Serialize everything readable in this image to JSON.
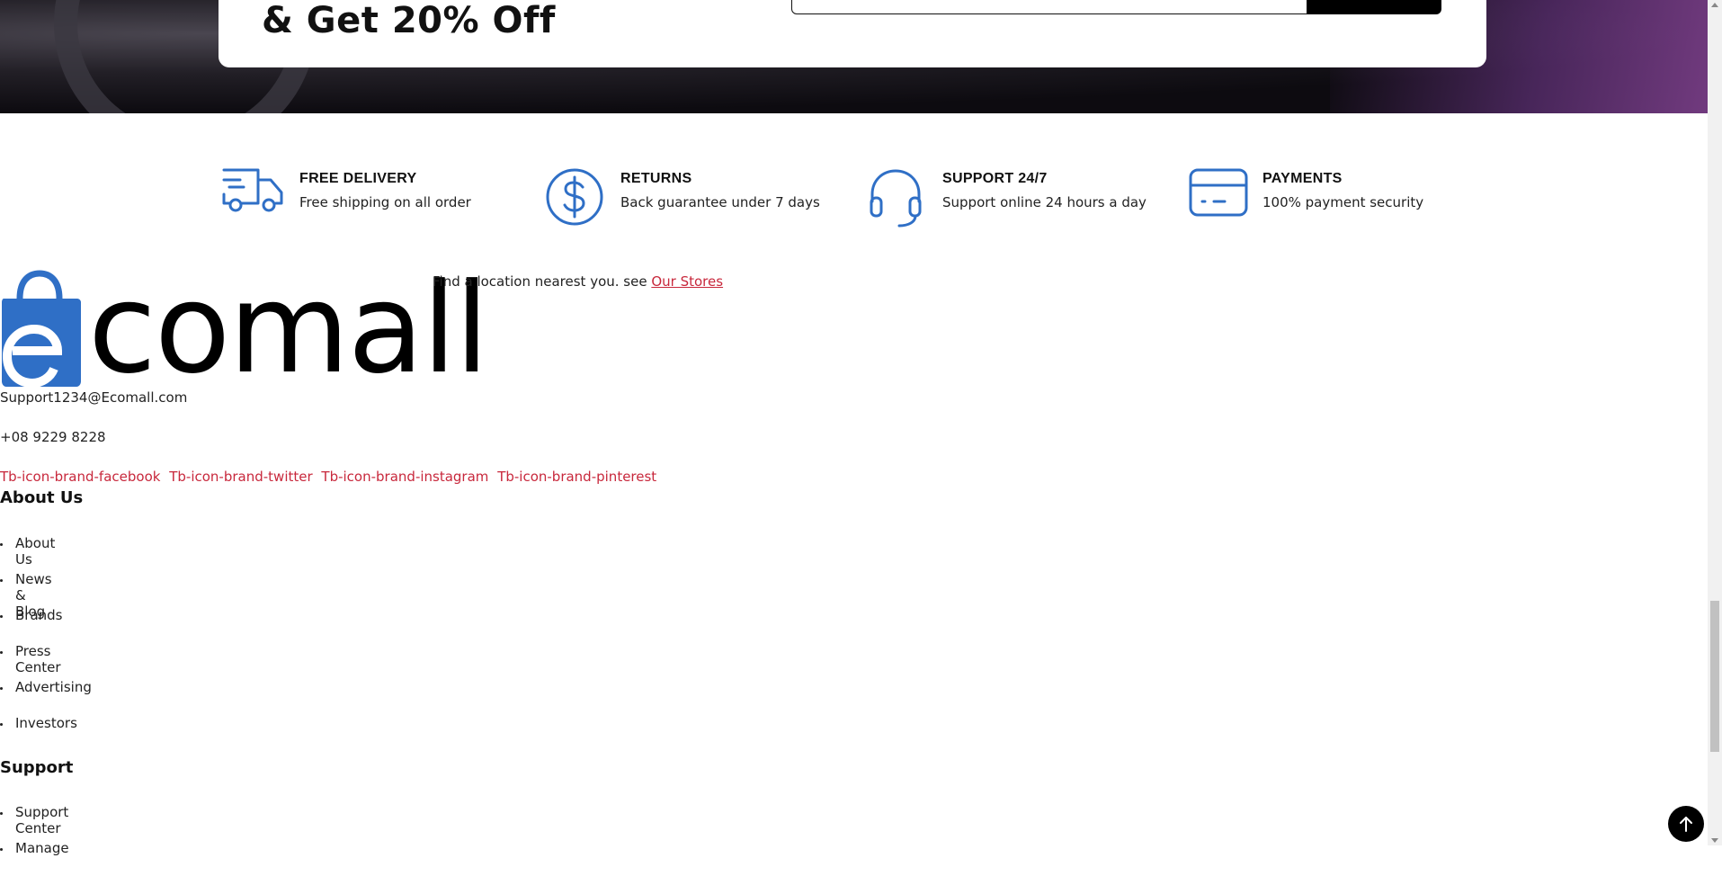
{
  "promo": {
    "title": "& Get 20% Off"
  },
  "colors": {
    "accent_blue": "#2f6fc6",
    "link_red": "#c8283c",
    "dark": "#000000"
  },
  "features": [
    {
      "icon": "delivery-truck-icon",
      "title": "FREE DELIVERY",
      "subtitle": "Free shipping on all order"
    },
    {
      "icon": "dollar-circle-icon",
      "title": "RETURNS",
      "subtitle": "Back guarantee under 7 days"
    },
    {
      "icon": "headset-icon",
      "title": "SUPPORT 24/7",
      "subtitle": "Support online 24 hours a day"
    },
    {
      "icon": "credit-card-icon",
      "title": "PAYMENTS",
      "subtitle": "100% payment security"
    }
  ],
  "footer": {
    "logo_text": "comall",
    "logo_letter": "e",
    "location_text": "Find a location nearest you. see ",
    "location_link": "Our Stores",
    "email": "Support1234@Ecomall.com",
    "phone": "+08 9229 8228",
    "socials": [
      "Tb-icon-brand-facebook",
      "Tb-icon-brand-twitter",
      "Tb-icon-brand-instagram",
      "Tb-icon-brand-pinterest"
    ],
    "about": {
      "title": "About Us",
      "links": [
        "About Us",
        "News & Blog",
        "Brands",
        "Press Center",
        "Advertising",
        "Investors"
      ]
    },
    "support": {
      "title": "Support",
      "links": [
        "Support Center",
        "Manage"
      ]
    }
  },
  "back_to_top_icon": "arrow-up-icon"
}
